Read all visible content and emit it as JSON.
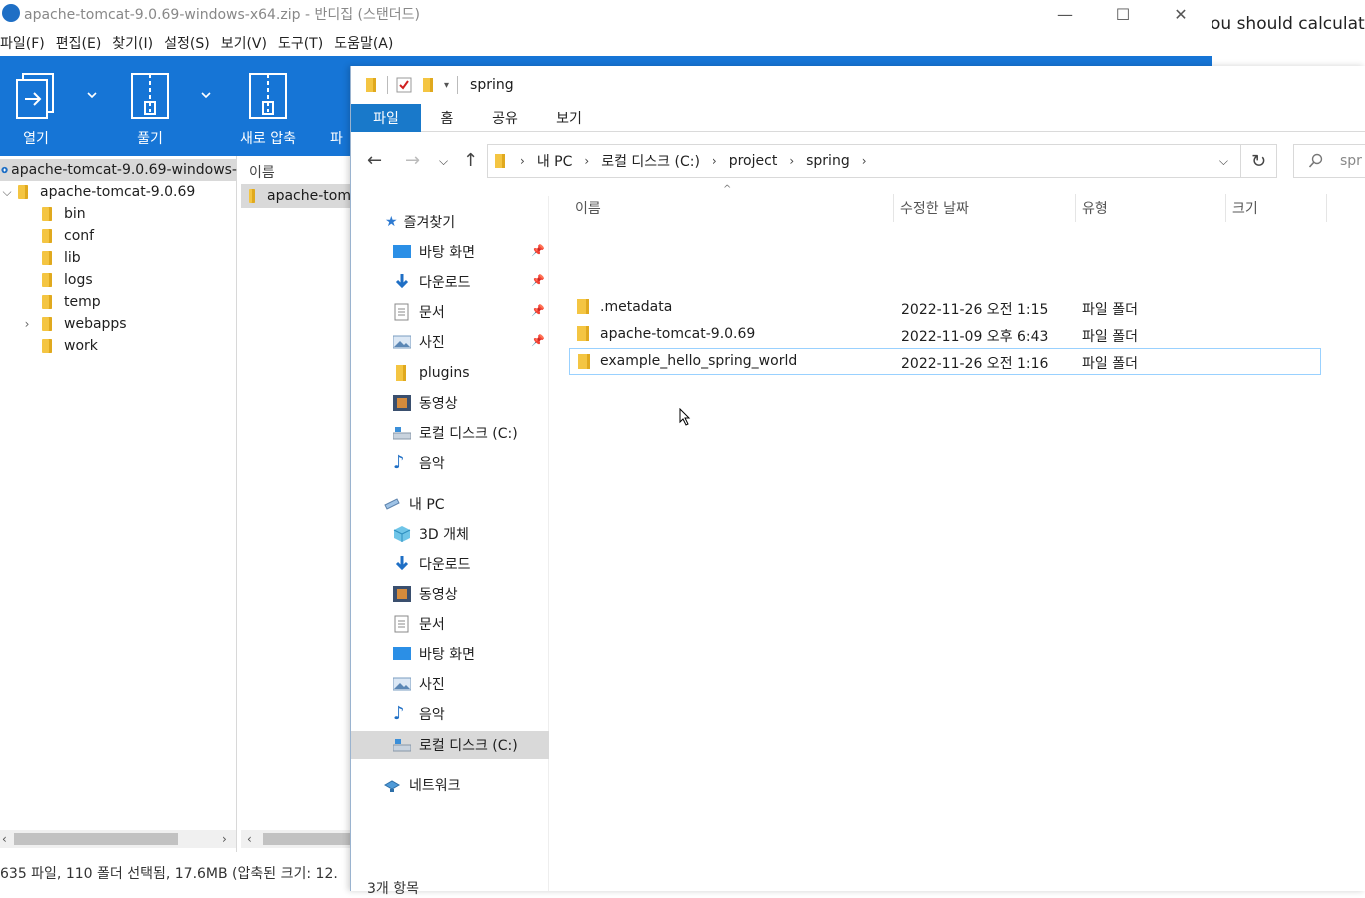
{
  "background": {
    "partial_text": "ou should calculate"
  },
  "bandizip": {
    "title": "apache-tomcat-9.0.69-windows-x64.zip - 반디집 (스탠더드)",
    "window_controls": [
      "—",
      "☐",
      "✕"
    ],
    "menu": [
      "파일(F)",
      "편집(E)",
      "찾기(I)",
      "설정(S)",
      "보기(V)",
      "도구(T)",
      "도움말(A)"
    ],
    "toolbar": {
      "open_label": "열기",
      "extract_label": "풀기",
      "new_archive_label": "새로 압축",
      "cut_label": "파"
    },
    "tree": {
      "root": "apache-tomcat-9.0.69-windows-",
      "folder": "apache-tomcat-9.0.69",
      "children": [
        "bin",
        "conf",
        "lib",
        "logs",
        "temp",
        "webapps",
        "work"
      ]
    },
    "list": {
      "header_name": "이름",
      "selected_row": "apache-tom"
    },
    "status": "635 파일, 110 폴더 선택됨, 17.6MB (압축된 크기: 12."
  },
  "explorer": {
    "title": "spring",
    "ribbon_tabs": [
      "파일",
      "홈",
      "공유",
      "보기"
    ],
    "address": [
      "내 PC",
      "로컬 디스크 (C:)",
      "project",
      "spring"
    ],
    "search_placeholder": "spr",
    "nav": {
      "quick_access": "즐겨찾기",
      "quick_items": [
        "바탕 화면",
        "다운로드",
        "문서",
        "사진",
        "plugins",
        "동영상",
        "로컬 디스크 (C:)",
        "음악"
      ],
      "this_pc": "내 PC",
      "pc_items": [
        "3D 개체",
        "다운로드",
        "동영상",
        "문서",
        "바탕 화면",
        "사진",
        "음악",
        "로컬 디스크 (C:)"
      ],
      "network": "네트워크"
    },
    "columns": {
      "name": "이름",
      "modified": "수정한 날짜",
      "type": "유형",
      "size": "크기"
    },
    "files": [
      {
        "name": ".metadata",
        "modified": "2022-11-26 오전 1:15",
        "type": "파일 폴더"
      },
      {
        "name": "apache-tomcat-9.0.69",
        "modified": "2022-11-09 오후 6:43",
        "type": "파일 폴더"
      },
      {
        "name": "example_hello_spring_world",
        "modified": "2022-11-26 오전 1:16",
        "type": "파일 폴더"
      }
    ],
    "status": "3개 항목"
  }
}
